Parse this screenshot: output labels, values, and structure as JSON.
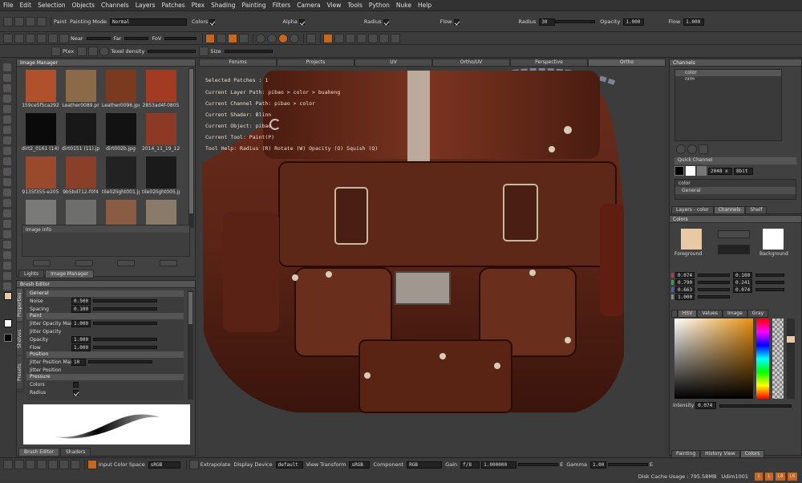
{
  "menu": [
    "File",
    "Edit",
    "Selection",
    "Objects",
    "Channels",
    "Layers",
    "Patches",
    "Ptex",
    "Shading",
    "Painting",
    "Filters",
    "Camera",
    "View",
    "Tools",
    "Python",
    "Nuke",
    "Help"
  ],
  "paint_bar": {
    "paint_label": "Paint",
    "mode_label": "Painting Mode",
    "mode_value": "Normal",
    "colors_label": "Colors",
    "alpha_label": "Alpha",
    "radius_label": "Radius",
    "flow_label": "Flow",
    "radius2_label": "Radius",
    "radius2_value": "30",
    "opacity_label": "Opacity",
    "opacity_value": "1.000",
    "flow2_label": "Flow",
    "flow2_value": "1.000"
  },
  "view_bar": {
    "near_label": "Near",
    "far_label": "Far",
    "fov_label": "FoV"
  },
  "ptex_bar": {
    "ptex_label": "Ptex",
    "texel_label": "Texel density",
    "size_label": "Size"
  },
  "image_manager": {
    "title": "Image Manager",
    "thumbs": [
      {
        "cap": "159ce5f5ca292",
        "color": "#b0502c"
      },
      {
        "cap": "Leather0089.pr",
        "color": "#8a6a48"
      },
      {
        "cap": "Leather0096.jpg",
        "color": "#7a3a20"
      },
      {
        "cap": "2853ad4f-0805",
        "color": "#a33a22"
      },
      {
        "cap": "dirt2_0161 (14).j",
        "color": "#0a0a0a"
      },
      {
        "cap": "dirt0151 (11).jpg",
        "color": "#181818"
      },
      {
        "cap": "dirt002b.jpg",
        "color": "#121212"
      },
      {
        "cap": "2014_11_19_12",
        "color": "#8c3a26"
      },
      {
        "cap": "9135f355-e205",
        "color": "#9a4a2c"
      },
      {
        "cap": "9b5bd712-f0f4",
        "color": "#8a4028"
      },
      {
        "cap": "tile02light001.jp",
        "color": "#222222"
      },
      {
        "cap": "tile02light005.jp",
        "color": "#1a1a1a"
      },
      {
        "cap": "MetalBare0072",
        "color": "#7a7a78"
      },
      {
        "cap": "MetalBare0019",
        "color": "#6e6e6c"
      },
      {
        "cap": "MetalPainted00",
        "color": "#8a5c44"
      },
      {
        "cap": "MetalBare0123",
        "color": "#8a7a6a"
      }
    ],
    "info_label": "Image Info",
    "tabs": [
      "Lights",
      "Image Manager"
    ]
  },
  "brush_editor": {
    "title": "Brush Editor",
    "side_tabs": [
      "Properties",
      "Shelves",
      "Presets"
    ],
    "sections": {
      "general": "General",
      "paint": "Paint",
      "jitter": "Jitter",
      "position": "Position",
      "pressure": "Pressure"
    },
    "rows": {
      "noise": {
        "label": "Noise",
        "value": "0.500"
      },
      "spacing": {
        "label": "Spacing",
        "value": "0.100"
      },
      "jitter_opacity_max": {
        "label": "Jitter Opacity Max",
        "value": "1.000"
      },
      "jitter_opacity": {
        "label": "Jitter Opacity"
      },
      "opacity": {
        "label": "Opacity",
        "value": "1.000"
      },
      "flow": {
        "label": "Flow",
        "value": "1.000"
      },
      "jitter_position_max": {
        "label": "Jitter Position Max",
        "value": "10"
      },
      "jitter_position": {
        "label": "Jitter Position"
      },
      "colors": {
        "label": "Colors"
      },
      "radius": {
        "label": "Radius"
      }
    },
    "bottom_tabs": [
      "Brush Editor",
      "Shaders"
    ]
  },
  "viewport": {
    "tabs": [
      "Forums",
      "Projects",
      "UV",
      "Ortho/UV",
      "Perspective",
      "Ortho"
    ],
    "active_tab": "Ortho",
    "hud": {
      "selected": "Selected Patches : 1",
      "layer_path": "Current Layer Path: pibao > color > buaheng",
      "channel_path": "Current Channel Path: pibao > color",
      "shader": "Current Shader: Blinn",
      "object": "Current Object: pibao",
      "tool": "Current Tool: Paint(P)",
      "help": "Tool Help:   Radius (R)   Rotate (W)   Opacity (O)   Squish (Q)"
    }
  },
  "channels": {
    "title": "Channels",
    "items": [
      "color",
      "nrm"
    ],
    "quick_title": "Quick Channel",
    "size_value": "2048 x 20",
    "depth_value": "8bit",
    "quick_items": [
      "color",
      "General"
    ],
    "tabs": [
      "Layers - color",
      "Channels",
      "Shelf"
    ]
  },
  "colors": {
    "title": "Colors",
    "foreground_label": "Foreground",
    "background_label": "Background",
    "fg_color": "#e8c9a5",
    "bg_color": "#ffffff",
    "left_values": [
      "0.074",
      "0.790",
      "0.663",
      "1.000"
    ],
    "right_values": [
      "0.100",
      "0.241",
      "0.074"
    ],
    "tabs": [
      "HSV",
      "Values",
      "Image",
      "Gray"
    ],
    "intensity_label": "Intensity",
    "intensity_value": "0.074",
    "bottom_tabs": [
      "Painting",
      "History View",
      "Colors"
    ]
  },
  "bottom_bar": {
    "input_color_space_label": "Input Color Space",
    "input_color_space_value": "sRGB",
    "extrapolate_label": "Extrapolate",
    "display_device_label": "Display Device",
    "display_device_value": "default",
    "view_transform_label": "View Transform",
    "view_transform_value": "sRGB",
    "component_label": "Component",
    "component_value": "RGB",
    "gain_label": "Gain",
    "gain_value": "f/8",
    "gain_num": "1.000000",
    "e_label": "E",
    "gamma_label": "Gamma",
    "gamma_value": "1.00",
    "e2_label": "E",
    "disk_cache": "Disk Cache Usage : 795.58MB",
    "udim": "Udim1001",
    "tags": [
      "1",
      "L",
      "L8",
      "L6"
    ]
  }
}
